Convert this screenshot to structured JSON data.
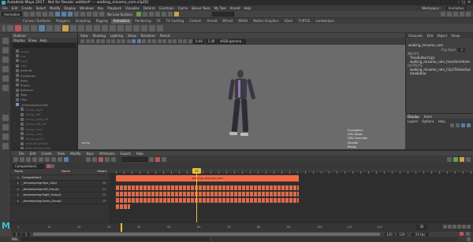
{
  "window": {
    "title": "Autodesk Maya 2017 - Not for Resale: untitled*  ---  walking_mixamo_com.clip[0]",
    "controls": [
      "–",
      "□",
      "✕"
    ]
  },
  "menubar": {
    "items": [
      "File",
      "Edit",
      "Create",
      "Select",
      "Modify",
      "Display",
      "Windows",
      "Key",
      "Playback",
      "Visualize",
      "Deform",
      "Constrain",
      "Cache",
      "Bonus Tools",
      "My Tool",
      "Arnold",
      "Help"
    ],
    "workspace_label": "Workspace :",
    "workspace_value": "Animation"
  },
  "statusline": {
    "mode": "Animation",
    "live_surface": "No Live Surface"
  },
  "shelf": {
    "tabs": [
      "Curves / Surfaces",
      "Polygons",
      "Sculpting",
      "Rigging",
      "Animation",
      "Rendering",
      "FX",
      "FX Caching",
      "Custom",
      "Arnold",
      "Bifrost",
      "MASH",
      "Motion Graphics",
      "XGen",
      "TURTLE",
      "Lumberjack"
    ],
    "active_tab": "Animation"
  },
  "outliner": {
    "title": "Outliner",
    "menu": [
      "Display",
      "Show",
      "Help"
    ],
    "items": [
      {
        "label": "persp",
        "dim": true
      },
      {
        "label": "top",
        "dim": true
      },
      {
        "label": "front",
        "dim": true
      },
      {
        "label": "side",
        "dim": true
      },
      {
        "label": "defaultL",
        "dim": false
      },
      {
        "label": "Eyelashes",
        "dim": false
      },
      {
        "label": "Body",
        "dim": false
      },
      {
        "label": "Shoes",
        "dim": false
      },
      {
        "label": "Bottoms",
        "dim": false
      },
      {
        "label": "Tops",
        "dim": false
      },
      {
        "label": "Hips",
        "dim": false
      },
      {
        "label": "_timewarping:Hips",
        "dim": false,
        "group": true
      },
      {
        "label": "Group_right",
        "dim": true,
        "indent": true
      },
      {
        "label": "Group_left",
        "dim": true,
        "indent": true
      },
      {
        "label": "Group_right_off",
        "dim": true,
        "indent": true
      },
      {
        "label": "Group_left_off",
        "dim": true,
        "indent": true
      },
      {
        "label": "Group_main",
        "dim": true,
        "indent": true
      },
      {
        "label": "Group_walk",
        "dim": true,
        "indent": true
      },
      {
        "label": "Group_spine",
        "dim": true,
        "indent": true
      },
      {
        "label": "defaultLightSet",
        "dim": true,
        "indent": true
      },
      {
        "label": "defaultObjectSet",
        "dim": true,
        "indent": true
      }
    ]
  },
  "viewport": {
    "menu": [
      "View",
      "Shading",
      "Lighting",
      "Show",
      "Renderer",
      "Panels"
    ],
    "color_space": "sRGB gamma",
    "exposure": "0.00",
    "gamma": "1.00",
    "hud": {
      "labels": [
        "Evaluation:",
        "GPU State:",
        "GPU Override:"
      ],
      "values": [
        "Parallel",
        "Ready",
        "Enabled (1k)"
      ],
      "fps": "11.0 fps"
    },
    "axis_label": "persp"
  },
  "channelbox": {
    "tabs": [
      "Channels",
      "Edit",
      "Object",
      "Show"
    ],
    "title": "walking_mixamo_com",
    "inputs_label": "INPUTS",
    "inputs": [
      "TimeEditorClip1",
      "walking_mixamo_com_transformAnim"
    ],
    "outputs_label": "OUTPUTS",
    "outputs": [
      "walking_mixamo_com_Clip1ToSubclips",
      "timeEditor"
    ],
    "clip_start_label": "Clip Start",
    "clip_start": "0"
  },
  "layers": {
    "tabs": [
      "Display",
      "Anim"
    ],
    "menu": [
      "Layers",
      "Options",
      "Help"
    ]
  },
  "timeeditor": {
    "menu": [
      "File",
      "Edit",
      "Create",
      "View",
      "Modify",
      "Keys",
      "Attributes",
      "Export",
      "Help"
    ],
    "filter_placeholder": "Composition1",
    "search_placeholder": "search...",
    "track_header": {
      "tracks": "Tracks",
      "name": "Name",
      "height": "Height"
    },
    "tracks": [
      {
        "name": "Composition1",
        "num": "",
        "top": true
      },
      {
        "name": "_timewarping:Hips_Clip1",
        "num": "10"
      },
      {
        "name": "_timewarping:Left_Group1",
        "num": "11"
      },
      {
        "name": "_timewarping:Right_Group1",
        "num": "12"
      },
      {
        "name": "_timewarping:Spine_Group1",
        "num": "13"
      }
    ],
    "clip_label": "walking_mixamo_com",
    "current_frame": "35"
  },
  "timeslider": {
    "ticks": [
      "1",
      "10",
      "20",
      "30",
      "40",
      "50",
      "60",
      "70",
      "80",
      "90",
      "100",
      "110",
      "120"
    ],
    "current": "35"
  },
  "rangeslider": {
    "start": "1",
    "end": "120",
    "range_start": "1",
    "range_end": "120",
    "fps": "24 fps"
  },
  "cmdline": {
    "lang": "MEL"
  },
  "colors": {
    "accent": "#f06a45",
    "timeline_marker": "#e6c13c",
    "maya_teal": "#3fbfcf"
  }
}
